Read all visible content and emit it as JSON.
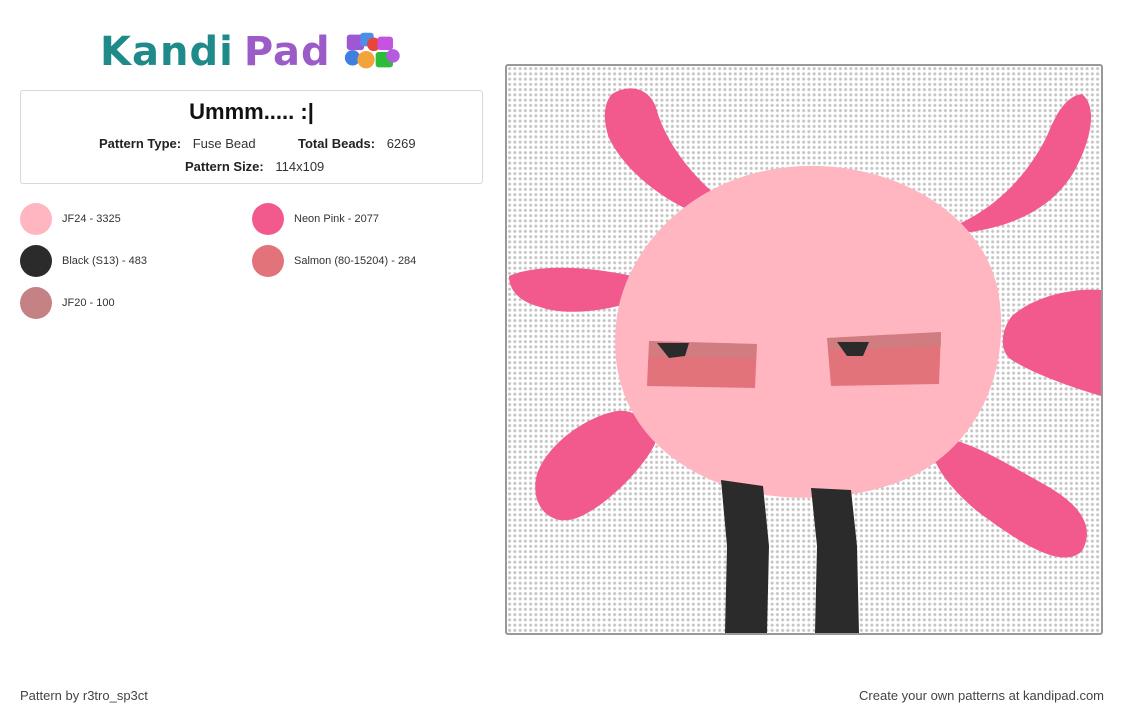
{
  "logo": {
    "kandi": "Kandi",
    "pad": "Pad"
  },
  "pattern": {
    "title": "Ummm..... :|",
    "type_label": "Pattern Type:",
    "type_value": "Fuse Bead",
    "beads_label": "Total Beads:",
    "beads_value": "6269",
    "size_label": "Pattern Size:",
    "size_value": "114x109"
  },
  "colors": [
    {
      "label": "JF24 - 3325",
      "hex": "#ffb6c1"
    },
    {
      "label": "Neon Pink - 2077",
      "hex": "#f25a8e"
    },
    {
      "label": "Black (S13) - 483",
      "hex": "#2b2b2b"
    },
    {
      "label": "Salmon (80-15204) - 284",
      "hex": "#e2737a"
    },
    {
      "label": "JF20 - 100",
      "hex": "#c48284"
    }
  ],
  "footer": {
    "author": "Pattern by r3tro_sp3ct",
    "cta": "Create your own patterns at kandipad.com"
  }
}
